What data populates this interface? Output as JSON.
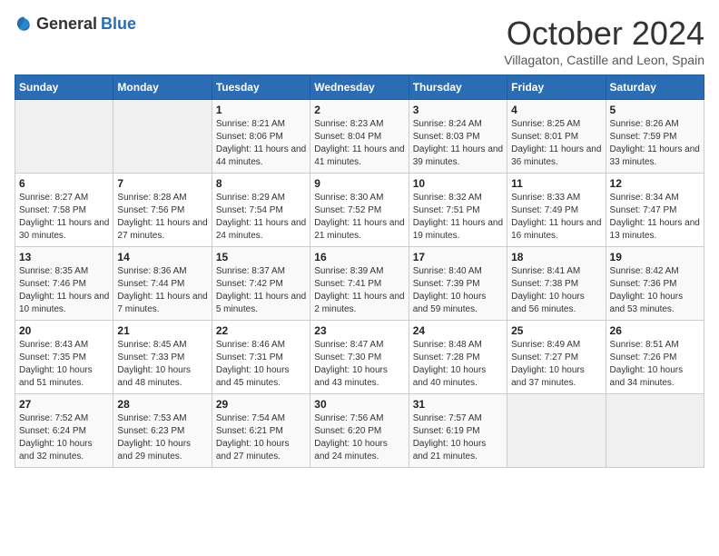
{
  "logo": {
    "general": "General",
    "blue": "Blue"
  },
  "title": "October 2024",
  "subtitle": "Villagaton, Castille and Leon, Spain",
  "days_of_week": [
    "Sunday",
    "Monday",
    "Tuesday",
    "Wednesday",
    "Thursday",
    "Friday",
    "Saturday"
  ],
  "weeks": [
    [
      {
        "day": "",
        "sunrise": "",
        "sunset": "",
        "daylight": ""
      },
      {
        "day": "",
        "sunrise": "",
        "sunset": "",
        "daylight": ""
      },
      {
        "day": "1",
        "sunrise": "Sunrise: 8:21 AM",
        "sunset": "Sunset: 8:06 PM",
        "daylight": "Daylight: 11 hours and 44 minutes."
      },
      {
        "day": "2",
        "sunrise": "Sunrise: 8:23 AM",
        "sunset": "Sunset: 8:04 PM",
        "daylight": "Daylight: 11 hours and 41 minutes."
      },
      {
        "day": "3",
        "sunrise": "Sunrise: 8:24 AM",
        "sunset": "Sunset: 8:03 PM",
        "daylight": "Daylight: 11 hours and 39 minutes."
      },
      {
        "day": "4",
        "sunrise": "Sunrise: 8:25 AM",
        "sunset": "Sunset: 8:01 PM",
        "daylight": "Daylight: 11 hours and 36 minutes."
      },
      {
        "day": "5",
        "sunrise": "Sunrise: 8:26 AM",
        "sunset": "Sunset: 7:59 PM",
        "daylight": "Daylight: 11 hours and 33 minutes."
      }
    ],
    [
      {
        "day": "6",
        "sunrise": "Sunrise: 8:27 AM",
        "sunset": "Sunset: 7:58 PM",
        "daylight": "Daylight: 11 hours and 30 minutes."
      },
      {
        "day": "7",
        "sunrise": "Sunrise: 8:28 AM",
        "sunset": "Sunset: 7:56 PM",
        "daylight": "Daylight: 11 hours and 27 minutes."
      },
      {
        "day": "8",
        "sunrise": "Sunrise: 8:29 AM",
        "sunset": "Sunset: 7:54 PM",
        "daylight": "Daylight: 11 hours and 24 minutes."
      },
      {
        "day": "9",
        "sunrise": "Sunrise: 8:30 AM",
        "sunset": "Sunset: 7:52 PM",
        "daylight": "Daylight: 11 hours and 21 minutes."
      },
      {
        "day": "10",
        "sunrise": "Sunrise: 8:32 AM",
        "sunset": "Sunset: 7:51 PM",
        "daylight": "Daylight: 11 hours and 19 minutes."
      },
      {
        "day": "11",
        "sunrise": "Sunrise: 8:33 AM",
        "sunset": "Sunset: 7:49 PM",
        "daylight": "Daylight: 11 hours and 16 minutes."
      },
      {
        "day": "12",
        "sunrise": "Sunrise: 8:34 AM",
        "sunset": "Sunset: 7:47 PM",
        "daylight": "Daylight: 11 hours and 13 minutes."
      }
    ],
    [
      {
        "day": "13",
        "sunrise": "Sunrise: 8:35 AM",
        "sunset": "Sunset: 7:46 PM",
        "daylight": "Daylight: 11 hours and 10 minutes."
      },
      {
        "day": "14",
        "sunrise": "Sunrise: 8:36 AM",
        "sunset": "Sunset: 7:44 PM",
        "daylight": "Daylight: 11 hours and 7 minutes."
      },
      {
        "day": "15",
        "sunrise": "Sunrise: 8:37 AM",
        "sunset": "Sunset: 7:42 PM",
        "daylight": "Daylight: 11 hours and 5 minutes."
      },
      {
        "day": "16",
        "sunrise": "Sunrise: 8:39 AM",
        "sunset": "Sunset: 7:41 PM",
        "daylight": "Daylight: 11 hours and 2 minutes."
      },
      {
        "day": "17",
        "sunrise": "Sunrise: 8:40 AM",
        "sunset": "Sunset: 7:39 PM",
        "daylight": "Daylight: 10 hours and 59 minutes."
      },
      {
        "day": "18",
        "sunrise": "Sunrise: 8:41 AM",
        "sunset": "Sunset: 7:38 PM",
        "daylight": "Daylight: 10 hours and 56 minutes."
      },
      {
        "day": "19",
        "sunrise": "Sunrise: 8:42 AM",
        "sunset": "Sunset: 7:36 PM",
        "daylight": "Daylight: 10 hours and 53 minutes."
      }
    ],
    [
      {
        "day": "20",
        "sunrise": "Sunrise: 8:43 AM",
        "sunset": "Sunset: 7:35 PM",
        "daylight": "Daylight: 10 hours and 51 minutes."
      },
      {
        "day": "21",
        "sunrise": "Sunrise: 8:45 AM",
        "sunset": "Sunset: 7:33 PM",
        "daylight": "Daylight: 10 hours and 48 minutes."
      },
      {
        "day": "22",
        "sunrise": "Sunrise: 8:46 AM",
        "sunset": "Sunset: 7:31 PM",
        "daylight": "Daylight: 10 hours and 45 minutes."
      },
      {
        "day": "23",
        "sunrise": "Sunrise: 8:47 AM",
        "sunset": "Sunset: 7:30 PM",
        "daylight": "Daylight: 10 hours and 43 minutes."
      },
      {
        "day": "24",
        "sunrise": "Sunrise: 8:48 AM",
        "sunset": "Sunset: 7:28 PM",
        "daylight": "Daylight: 10 hours and 40 minutes."
      },
      {
        "day": "25",
        "sunrise": "Sunrise: 8:49 AM",
        "sunset": "Sunset: 7:27 PM",
        "daylight": "Daylight: 10 hours and 37 minutes."
      },
      {
        "day": "26",
        "sunrise": "Sunrise: 8:51 AM",
        "sunset": "Sunset: 7:26 PM",
        "daylight": "Daylight: 10 hours and 34 minutes."
      }
    ],
    [
      {
        "day": "27",
        "sunrise": "Sunrise: 7:52 AM",
        "sunset": "Sunset: 6:24 PM",
        "daylight": "Daylight: 10 hours and 32 minutes."
      },
      {
        "day": "28",
        "sunrise": "Sunrise: 7:53 AM",
        "sunset": "Sunset: 6:23 PM",
        "daylight": "Daylight: 10 hours and 29 minutes."
      },
      {
        "day": "29",
        "sunrise": "Sunrise: 7:54 AM",
        "sunset": "Sunset: 6:21 PM",
        "daylight": "Daylight: 10 hours and 27 minutes."
      },
      {
        "day": "30",
        "sunrise": "Sunrise: 7:56 AM",
        "sunset": "Sunset: 6:20 PM",
        "daylight": "Daylight: 10 hours and 24 minutes."
      },
      {
        "day": "31",
        "sunrise": "Sunrise: 7:57 AM",
        "sunset": "Sunset: 6:19 PM",
        "daylight": "Daylight: 10 hours and 21 minutes."
      },
      {
        "day": "",
        "sunrise": "",
        "sunset": "",
        "daylight": ""
      },
      {
        "day": "",
        "sunrise": "",
        "sunset": "",
        "daylight": ""
      }
    ]
  ]
}
